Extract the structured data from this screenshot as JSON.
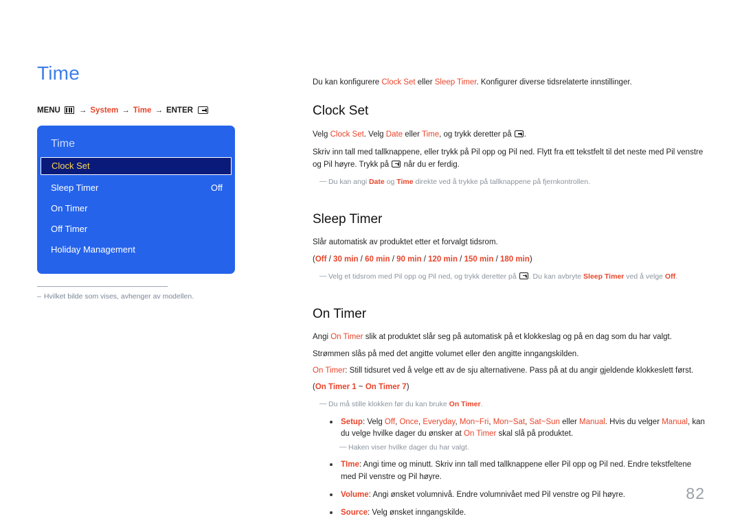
{
  "page": {
    "title": "Time",
    "number": "82",
    "accent_blue": "#3d7ee8",
    "accent_red": "#e8442a",
    "osd_blue": "#2563eb",
    "osd_selected_bg": "#0a1a7a",
    "osd_selected_text": "#ffd84d"
  },
  "breadcrumb": {
    "menu_label": "MENU",
    "menu_icon": "menu-grid-icon",
    "arrow": "→",
    "item1": "System",
    "item2": "Time",
    "enter_label": "ENTER",
    "enter_icon": "enter-key-icon"
  },
  "osd": {
    "title": "Time",
    "rows": [
      {
        "label": "Clock Set",
        "value": "",
        "selected": true
      },
      {
        "label": "Sleep Timer",
        "value": "Off",
        "selected": false
      },
      {
        "label": "On Timer",
        "value": "",
        "selected": false
      },
      {
        "label": "Off Timer",
        "value": "",
        "selected": false
      },
      {
        "label": "Holiday Management",
        "value": "",
        "selected": false
      }
    ]
  },
  "left_note": {
    "dash": "–",
    "text": "Hvilket bilde som vises, avhenger av modellen."
  },
  "intro": {
    "t1": "Du kan konfigurere ",
    "r1": "Clock Set",
    "t2": " eller ",
    "r2": "Sleep Timer",
    "t3": ". Konfigurer diverse tidsrelaterte innstillinger."
  },
  "clock_set": {
    "heading": "Clock Set",
    "p1": {
      "t1": "Velg ",
      "r1": "Clock Set",
      "t2": ". Velg ",
      "r2": "Date",
      "t3": " eller ",
      "r3": "Time",
      "t4": ", og trykk deretter på ",
      "t5": "."
    },
    "p2": {
      "t1": "Skriv inn tall med tallknappene, eller trykk på Pil opp og Pil ned. Flytt fra ett tekstfelt til det neste med Pil venstre og Pil høyre. Trykk på ",
      "t2": " når du er ferdig."
    },
    "note": {
      "dash": "—",
      "t1": "Du kan angi ",
      "r1": "Date",
      "t2": " og ",
      "r2": "Time",
      "t3": " direkte ved å trykke på tallknappene på fjernkontrollen."
    }
  },
  "sleep_timer": {
    "heading": "Sleep Timer",
    "p1": "Slår automatisk av produktet etter et forvalgt tidsrom.",
    "options_prefix": "(",
    "options": [
      "Off",
      "30 min",
      "60 min",
      "90 min",
      "120 min",
      "150 min",
      "180 min"
    ],
    "options_separator": " / ",
    "options_suffix": ")",
    "note": {
      "dash": "—",
      "t1": "Velg et tidsrom med Pil opp og Pil ned, og trykk deretter på ",
      "t2": ". Du kan avbryte ",
      "r1": "Sleep Timer",
      "t3": " ved å velge ",
      "r2": "Off",
      "t4": "."
    }
  },
  "on_timer": {
    "heading": "On Timer",
    "p1": {
      "t1": "Angi ",
      "r1": "On Timer",
      "t2": " slik at produktet slår seg på automatisk på et klokkeslag og på en dag som du har valgt."
    },
    "p2": "Strømmen slås på med det angitte volumet eller den angitte inngangskilden.",
    "p3": {
      "r1": "On Timer",
      "t1": ": Still tidsuret ved å velge ett av de sju alternativene. Pass på at du angir gjeldende klokkeslett først."
    },
    "p4": {
      "t1": "(",
      "r1": "On Timer 1",
      "t2": " ~ ",
      "r2": "On Timer 7",
      "t3": ")"
    },
    "note": {
      "dash": "—",
      "t1": "Du må stille klokken før du kan bruke ",
      "r1": "On Timer",
      "t2": "."
    },
    "bullets": [
      {
        "label": "Setup",
        "t1": ": Velg ",
        "opts": [
          "Off",
          "Once",
          "Everyday",
          "Mon~Fri",
          "Mon~Sat",
          "Sat~Sun"
        ],
        "opts_sep": ", ",
        "t2": " eller ",
        "r_manual": "Manual",
        "t3": ". Hvis du velger ",
        "r_manual2": "Manual",
        "t4": ", kan du velge hvilke dager du ønsker at ",
        "r_ontimer": "On Timer",
        "t5": " skal slå på produktet.",
        "note": {
          "dash": "—",
          "text": "Haken viser hvilke dager du har valgt."
        }
      },
      {
        "label": "TIme",
        "t1": ": Angi time og minutt. Skriv inn tall med tallknappene eller Pil opp og Pil ned. Endre tekstfeltene med Pil venstre og Pil høyre."
      },
      {
        "label": "Volume",
        "t1": ": Angi ønsket volumnivå. Endre volumnivået med Pil venstre og Pil høyre."
      },
      {
        "label": "Source",
        "t1": ": Velg ønsket inngangskilde."
      }
    ]
  }
}
